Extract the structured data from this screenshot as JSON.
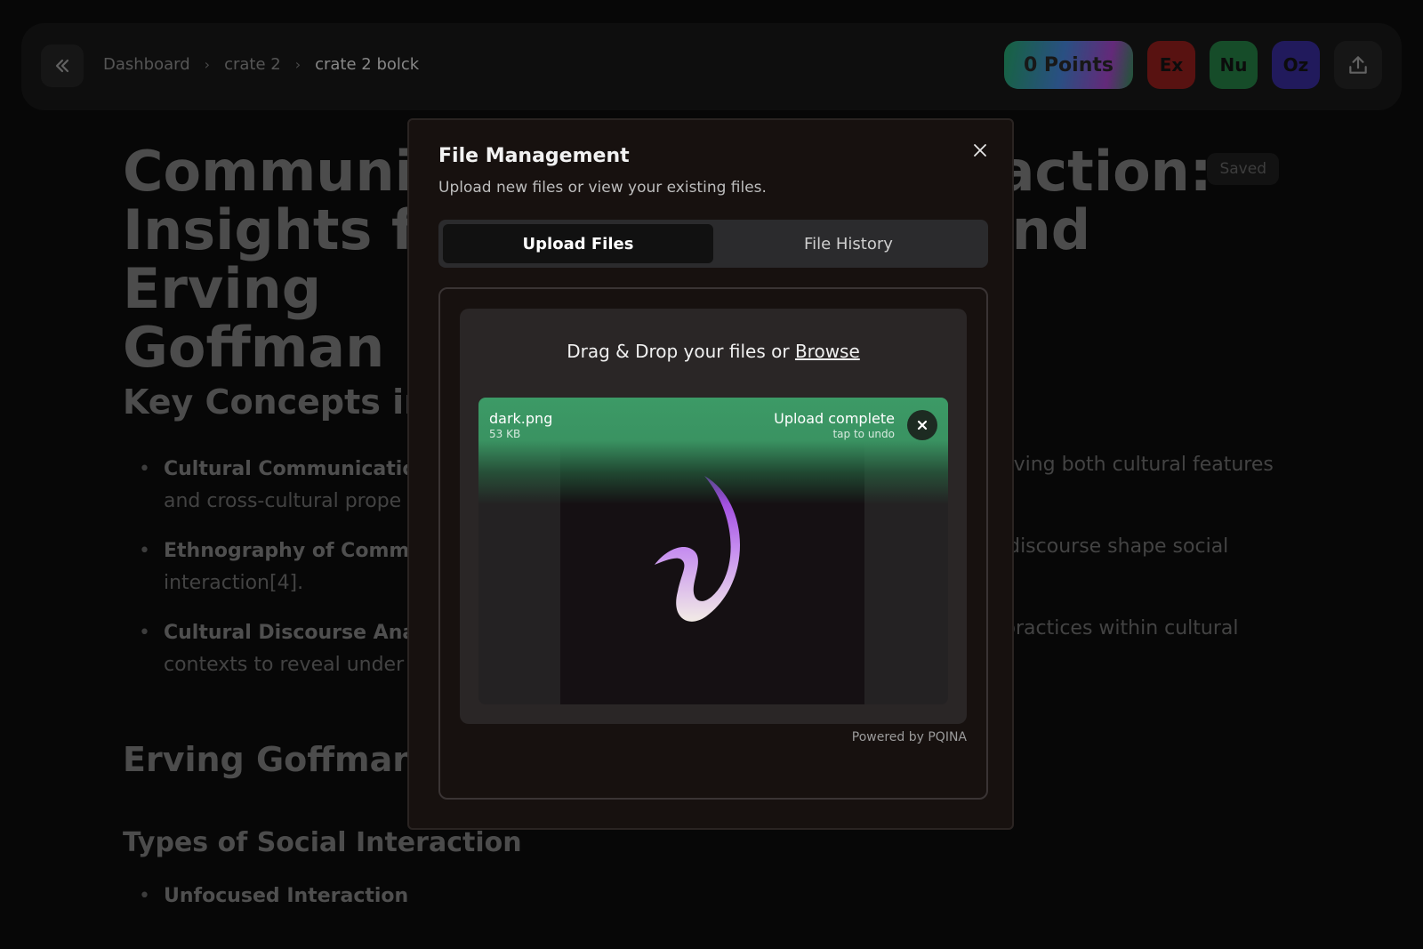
{
  "header": {
    "breadcrumb": [
      "Dashboard",
      "crate 2",
      "crate 2 bolck"
    ],
    "points_label": "0 Points",
    "avatars": [
      {
        "initials": "Ex",
        "color": "#b0201f"
      },
      {
        "initials": "Nu",
        "color": "#1f8a4a"
      },
      {
        "initials": "Oz",
        "color": "#3a2aa8"
      }
    ]
  },
  "document": {
    "title_line1": "Communic",
    "title_line1_right": "action:",
    "title_line2": "Insights fr",
    "title_line2_right": "nd Erving",
    "title_line3": "Goffman",
    "saved": "Saved",
    "h2_key": "Key Concepts in",
    "bullets": [
      {
        "bold": "Cultural Communicatio",
        "rest": "",
        "line2": "and cross-cultural prope",
        "right": "olving both cultural features"
      },
      {
        "bold": "Ethnography of Commu",
        "rest": "",
        "line2": "interaction[4].",
        "right": "l discourse shape social"
      },
      {
        "bold": "Cultural Discourse Anal",
        "rest": "",
        "line2": "contexts to reveal under",
        "right": "practices within cultural"
      }
    ],
    "h2_goffman": "Erving Goffman c",
    "h3_types": "Types of Social Interaction",
    "bullet_unfocused": "Unfocused Interaction"
  },
  "modal": {
    "title": "File Management",
    "description": "Upload new files or view your existing files.",
    "tabs": [
      {
        "label": "Upload Files",
        "active": true
      },
      {
        "label": "File History",
        "active": false
      }
    ],
    "drop_text": "Drag & Drop your files or ",
    "browse_text": "Browse",
    "file": {
      "name": "dark.png",
      "size": "53 KB",
      "status": "Upload complete",
      "sub": "tap to undo"
    },
    "credits": "Powered by PQINA",
    "colors": {
      "success": "#3c9a66",
      "panel": "#17110f"
    }
  }
}
